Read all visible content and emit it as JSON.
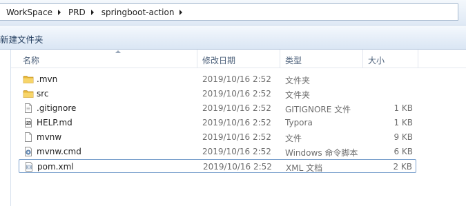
{
  "breadcrumb": [
    "WorkSpace",
    "PRD",
    "springboot-action"
  ],
  "toolbar": {
    "new_folder": "新建文件夹"
  },
  "columns": {
    "name": "名称",
    "modified": "修改日期",
    "type": "类型",
    "size": "大小"
  },
  "files": [
    {
      "name": ".mvn",
      "modified": "2019/10/16 2:52",
      "type": "文件夹",
      "size": "",
      "icon": "folder-icon"
    },
    {
      "name": "src",
      "modified": "2019/10/16 2:52",
      "type": "文件夹",
      "size": "",
      "icon": "folder-icon"
    },
    {
      "name": ".gitignore",
      "modified": "2019/10/16 2:52",
      "type": "GITIGNORE 文件",
      "size": "1 KB",
      "icon": "file-icon"
    },
    {
      "name": "HELP.md",
      "modified": "2019/10/16 2:52",
      "type": "Typora",
      "size": "1 KB",
      "icon": "markdown-file-icon"
    },
    {
      "name": "mvnw",
      "modified": "2019/10/16 2:52",
      "type": "文件",
      "size": "9 KB",
      "icon": "blank-file-icon"
    },
    {
      "name": "mvnw.cmd",
      "modified": "2019/10/16 2:52",
      "type": "Windows 命令脚本",
      "size": "6 KB",
      "icon": "cmd-script-icon"
    },
    {
      "name": "pom.xml",
      "modified": "2019/10/16 2:52",
      "type": "XML 文档",
      "size": "2 KB",
      "icon": "xml-file-icon"
    }
  ]
}
